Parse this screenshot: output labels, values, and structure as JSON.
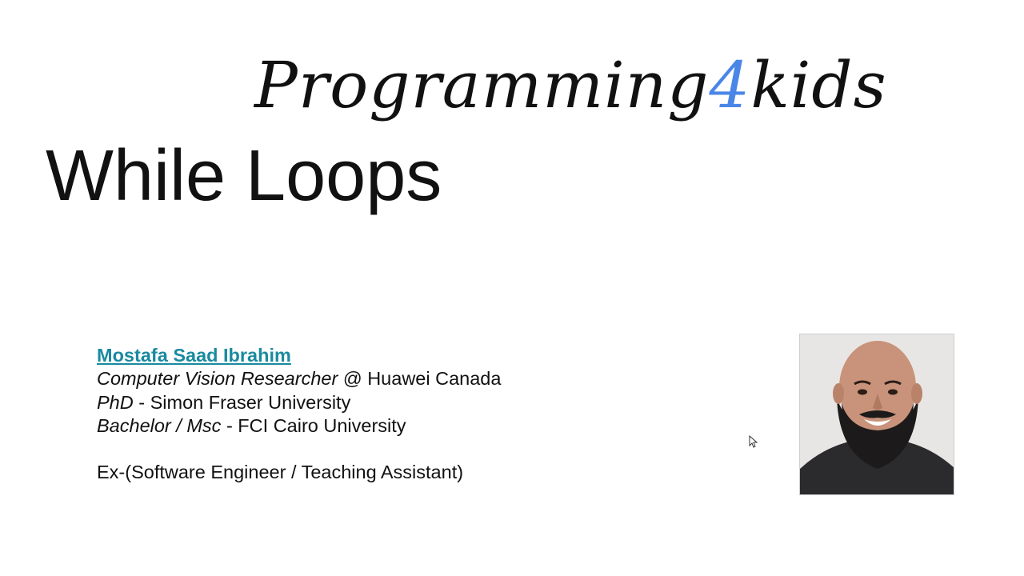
{
  "logo": {
    "part1": "Programming",
    "part2": "4",
    "part3": "kids"
  },
  "title": "While Loops",
  "bio": {
    "name": "Mostafa Saad Ibrahim",
    "line1_role": "Computer Vision Researcher",
    "line1_rest": " @ Huawei Canada",
    "line2_degree": "PhD",
    "line2_rest": " - Simon Fraser University",
    "line3_degree": "Bachelor / Msc",
    "line3_rest": " - FCI Cairo University",
    "line5": "Ex-(Software Engineer / Teaching Assistant)"
  },
  "colors": {
    "link": "#1a8aa0",
    "logo_accent": "#4a86e8",
    "text": "#111111",
    "background": "#ffffff"
  },
  "icons": {
    "cursor": "mouse-pointer-icon"
  }
}
